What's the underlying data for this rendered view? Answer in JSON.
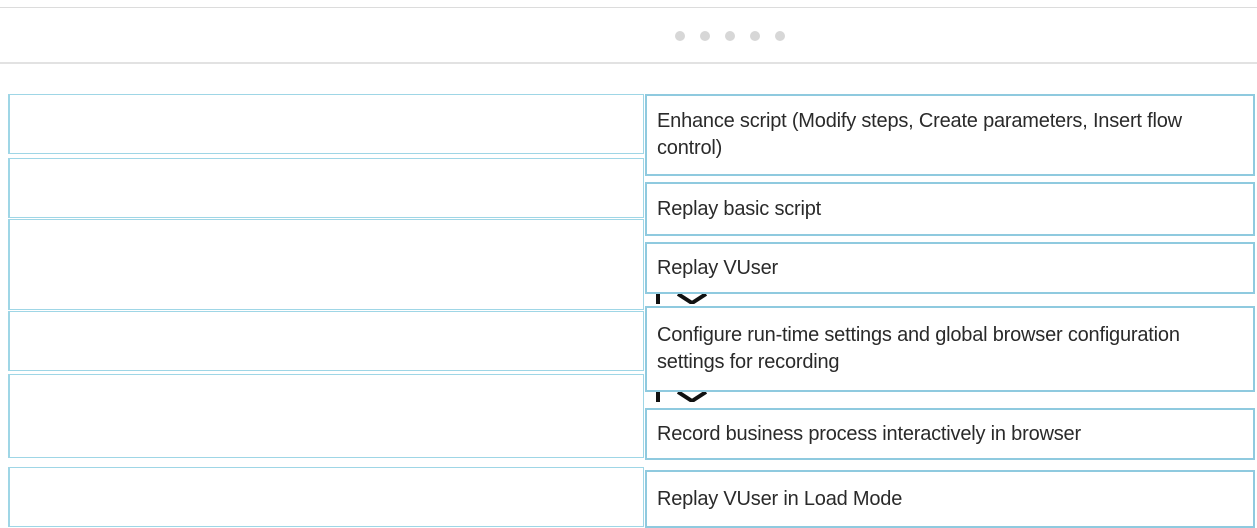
{
  "pager": {
    "dots": [
      "",
      "",
      "",
      "",
      ""
    ]
  },
  "drop_slots": [
    "",
    "",
    "",
    "",
    "",
    ""
  ],
  "drag_items": [
    {
      "label": "Enhance script (Modify steps, Create parameters, Insert flow control)"
    },
    {
      "label": "Replay basic script"
    },
    {
      "label": "Replay VUser"
    },
    {
      "label": "Configure run-time settings and global browser configuration settings for recording"
    },
    {
      "label": "Record business process interactively in browser"
    },
    {
      "label": "Replay VUser in Load Mode"
    }
  ],
  "colors": {
    "slot_border": "#9fd6e6",
    "item_border": "#8fcadf",
    "pager_dot": "#d7d7d7",
    "text": "#2a2a2a"
  }
}
